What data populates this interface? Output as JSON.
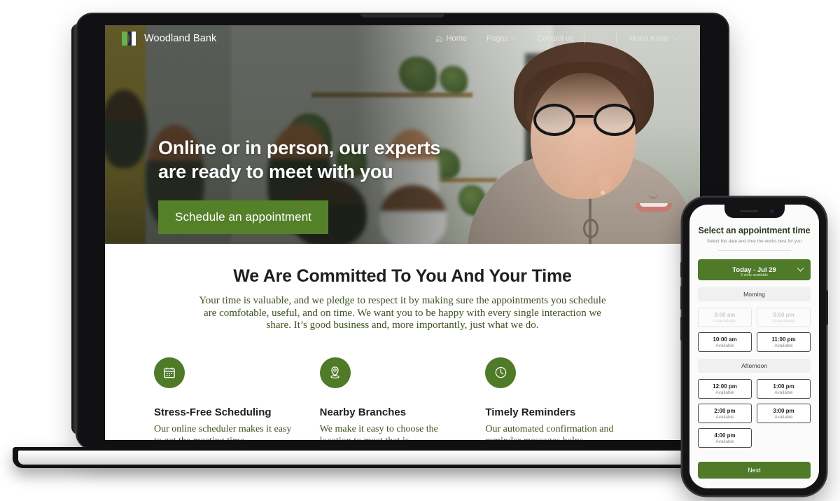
{
  "laptop": {
    "site": {
      "nav": {
        "brand": "Woodland Bank",
        "logo_icon": "woodland-flag-logo",
        "links": [
          {
            "label": "Home",
            "icon": "home-icon",
            "has_chevron": false
          },
          {
            "label": "Pages",
            "icon": "",
            "has_chevron": true
          },
          {
            "label": "Contact us",
            "icon": "",
            "has_chevron": false
          }
        ],
        "search_icon": "search-icon",
        "user": {
          "name": "Mona Kane",
          "has_chevron": true
        }
      },
      "hero": {
        "title_line1": "Online or in person, our experts",
        "title_line2": "are ready to meet with you",
        "cta_label": "Schedule an appointment"
      },
      "commitment": {
        "heading": "We Are Committed To You And Your Time",
        "body": "Your time is valuable, and we pledge to respect it by making sure the appointments you schedule are comfotable, useful, and on time. We want you to be happy with every single interaction we share. It’s good business and, more importantly, just what we do."
      },
      "features": [
        {
          "icon": "calendar-icon",
          "title": "Stress-Free Scheduling",
          "body": "Our online scheduler makes it easy to get the meeting time"
        },
        {
          "icon": "map-pin-icon",
          "title": "Nearby Branches",
          "body": "We make it easy to choose the location to meet that is"
        },
        {
          "icon": "clock-icon",
          "title": "Timely Reminders",
          "body": "Our automated confirmation and reminder messages helps"
        }
      ]
    }
  },
  "phone": {
    "title": "Select an appointment time",
    "subtitle": "Select the date and time the works best for you",
    "date_selector": {
      "label": "Today - Jul 29",
      "sub": "3 slots available",
      "chevron_icon": "chevron-down-icon"
    },
    "sections": [
      {
        "heading": "Morning",
        "slots": [
          {
            "time": "8:00 am",
            "status": "Unavailable",
            "available": false
          },
          {
            "time": "9:00 pm",
            "status": "Unavailable",
            "available": false
          },
          {
            "time": "10:00 am",
            "status": "Available",
            "available": true
          },
          {
            "time": "11:00 pm",
            "status": "Available",
            "available": true
          }
        ]
      },
      {
        "heading": "Afternoon",
        "slots": [
          {
            "time": "12:00 pm",
            "status": "Available",
            "available": true
          },
          {
            "time": "1:00 pm",
            "status": "Available",
            "available": true
          },
          {
            "time": "2:00 pm",
            "status": "Available",
            "available": true
          },
          {
            "time": "3:00 pm",
            "status": "Available",
            "available": true
          },
          {
            "time": "4:00 pm",
            "status": "Available",
            "available": true
          }
        ]
      }
    ],
    "next_label": "Next"
  },
  "colors": {
    "brand_green": "#4f7a28",
    "cta_green": "#55802a",
    "body_green": "#3e5222",
    "heading_dark": "#1f1f21"
  }
}
